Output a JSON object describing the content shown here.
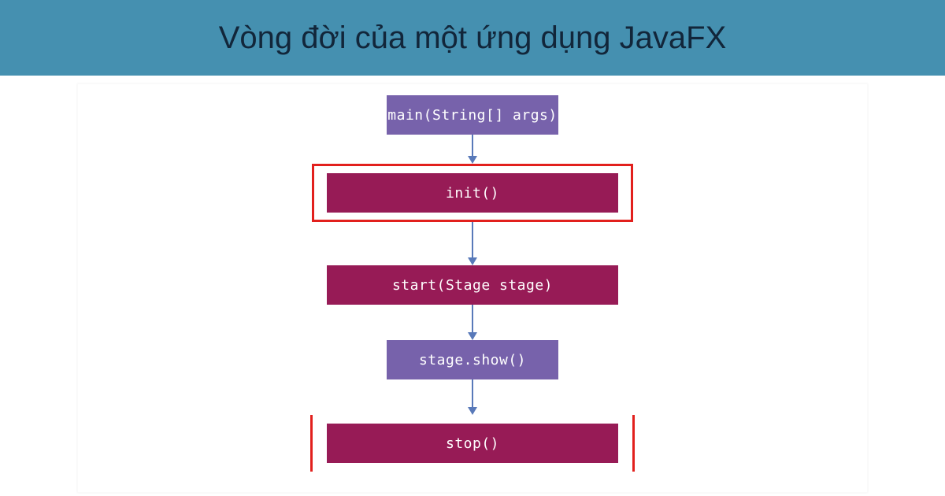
{
  "header": {
    "title": "Vòng đời của một ứng dụng JavaFX"
  },
  "diagram": {
    "nodes": {
      "main": {
        "label": "main(String[] args)",
        "color": "purple",
        "highlighted": false
      },
      "init": {
        "label": "init()",
        "color": "maroon",
        "highlighted": true
      },
      "start": {
        "label": "start(Stage stage)",
        "color": "maroon",
        "highlighted": false
      },
      "show": {
        "label": "stage.show()",
        "color": "purple",
        "highlighted": false
      },
      "stop": {
        "label": "stop()",
        "color": "maroon",
        "highlighted": true
      }
    },
    "flow": [
      "main",
      "init",
      "start",
      "show",
      "stop"
    ],
    "colors": {
      "purple": "#7762ab",
      "maroon": "#971b56",
      "highlight_border": "#e2201d",
      "arrow": "#5879b9",
      "header_bg": "#4590b0"
    }
  }
}
